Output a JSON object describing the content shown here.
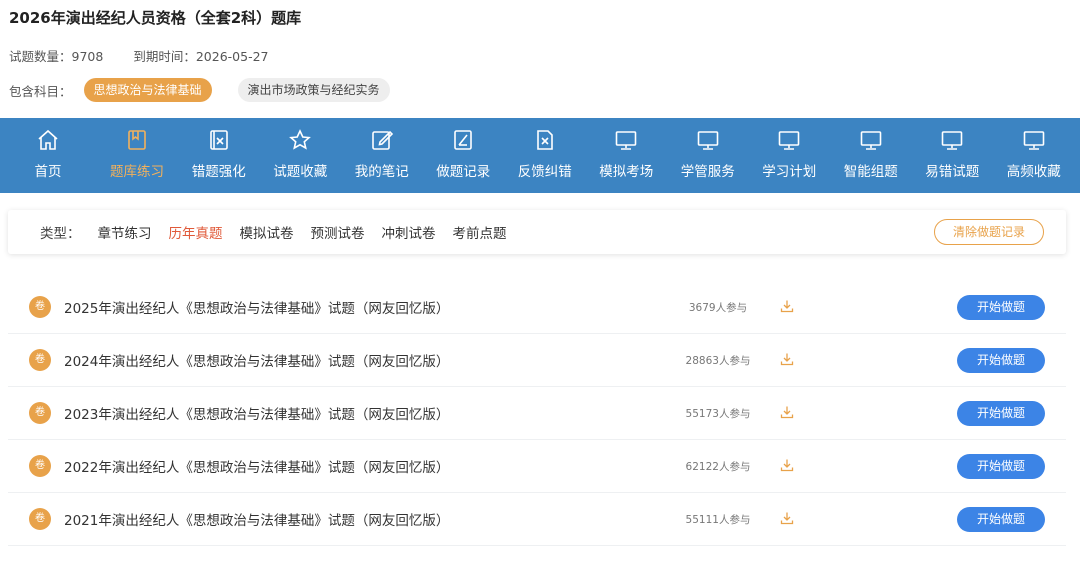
{
  "header": {
    "title": "2026年演出经纪人员资格（全套2科）题库",
    "count_label": "试题数量：",
    "count_value": "9708",
    "expire_label": "到期时间：",
    "expire_value": "2026-05-27",
    "subjects_label": "包含科目：",
    "subjects": [
      "思想政治与法律基础",
      "演出市场政策与经纪实务"
    ]
  },
  "nav": {
    "items": [
      {
        "label": "首页",
        "icon": "home-icon"
      },
      {
        "label": "题库练习",
        "icon": "book-icon"
      },
      {
        "label": "错题强化",
        "icon": "x-doc-icon"
      },
      {
        "label": "试题收藏",
        "icon": "star-icon"
      },
      {
        "label": "我的笔记",
        "icon": "edit-icon"
      },
      {
        "label": "做题记录",
        "icon": "record-icon"
      },
      {
        "label": "反馈纠错",
        "icon": "x-file-icon"
      },
      {
        "label": "模拟考场",
        "icon": "monitor-icon"
      },
      {
        "label": "学管服务",
        "icon": "monitor-icon"
      },
      {
        "label": "学习计划",
        "icon": "monitor-icon"
      },
      {
        "label": "智能组题",
        "icon": "monitor-icon"
      },
      {
        "label": "易错试题",
        "icon": "monitor-icon"
      },
      {
        "label": "高频收藏",
        "icon": "monitor-icon"
      }
    ],
    "active_color": "#f2b15c",
    "bg_color": "#3c84c2"
  },
  "filter": {
    "label": "类型：",
    "options": [
      "章节练习",
      "历年真题",
      "模拟试卷",
      "预测试卷",
      "冲刺试卷",
      "考前点题"
    ],
    "active": "历年真题",
    "clear_label": "清除做题记录"
  },
  "list": {
    "badge": "卷",
    "start_label": "开始做题",
    "rows": [
      {
        "title": "2025年演出经纪人《思想政治与法律基础》试题（网友回忆版）",
        "count": "3679人参与"
      },
      {
        "title": "2024年演出经纪人《思想政治与法律基础》试题（网友回忆版）",
        "count": "28863人参与"
      },
      {
        "title": "2023年演出经纪人《思想政治与法律基础》试题（网友回忆版）",
        "count": "55173人参与"
      },
      {
        "title": "2022年演出经纪人《思想政治与法律基础》试题（网友回忆版）",
        "count": "62122人参与"
      },
      {
        "title": "2021年演出经纪人《思想政治与法律基础》试题（网友回忆版）",
        "count": "55111人参与"
      }
    ]
  }
}
